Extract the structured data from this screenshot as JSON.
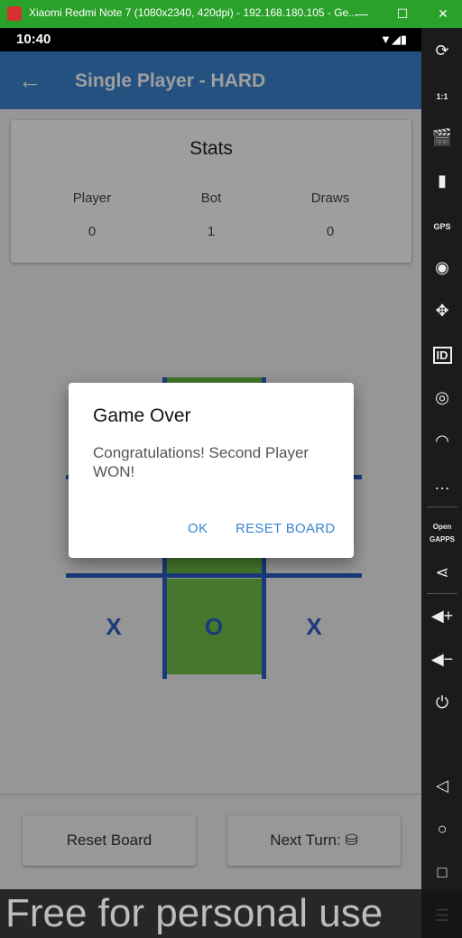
{
  "window": {
    "title": "Xiaomi Redmi Note 7 (1080x2340, 420dpi) - 192.168.180.105 - Ge...",
    "minimize": "—",
    "maximize": "☐",
    "close": "✕"
  },
  "statusbar": {
    "time": "10:40",
    "icons": "▼◢▮"
  },
  "appbar": {
    "back": "←",
    "title": "Single Player - HARD"
  },
  "stats": {
    "title": "Stats",
    "columns": [
      {
        "label": "Player",
        "value": "0"
      },
      {
        "label": "Bot",
        "value": "1"
      },
      {
        "label": "Draws",
        "value": "0"
      }
    ]
  },
  "board": {
    "cells": [
      "",
      "",
      "",
      "",
      "",
      "",
      "X",
      "O",
      "X"
    ]
  },
  "buttons": {
    "reset": "Reset Board",
    "next_turn": "Next Turn: ⛁"
  },
  "dialog": {
    "title": "Game Over",
    "message": "Congratulations! Second Player WON!",
    "ok": "OK",
    "reset": "RESET BOARD"
  },
  "sidebar": {
    "rotate": "⟳",
    "pixel": "1:1",
    "capture": "🎬",
    "battery": "▮",
    "gps": "GPS",
    "camera": "◉",
    "dpad": "✥",
    "id": "ID",
    "disk": "◎",
    "feed": "◠",
    "sms": "…",
    "gapps": "Open GAPPS",
    "share": "⋖",
    "volume_up": "◀+",
    "volume_down": "◀−",
    "power": "⏻",
    "back": "◁",
    "home": "○",
    "recents": "□",
    "menu": "☰"
  },
  "watermark": "Free for personal use",
  "colors": {
    "accent": "#3a84cf",
    "win": "#70c04a",
    "board": "#2b5fc6"
  }
}
